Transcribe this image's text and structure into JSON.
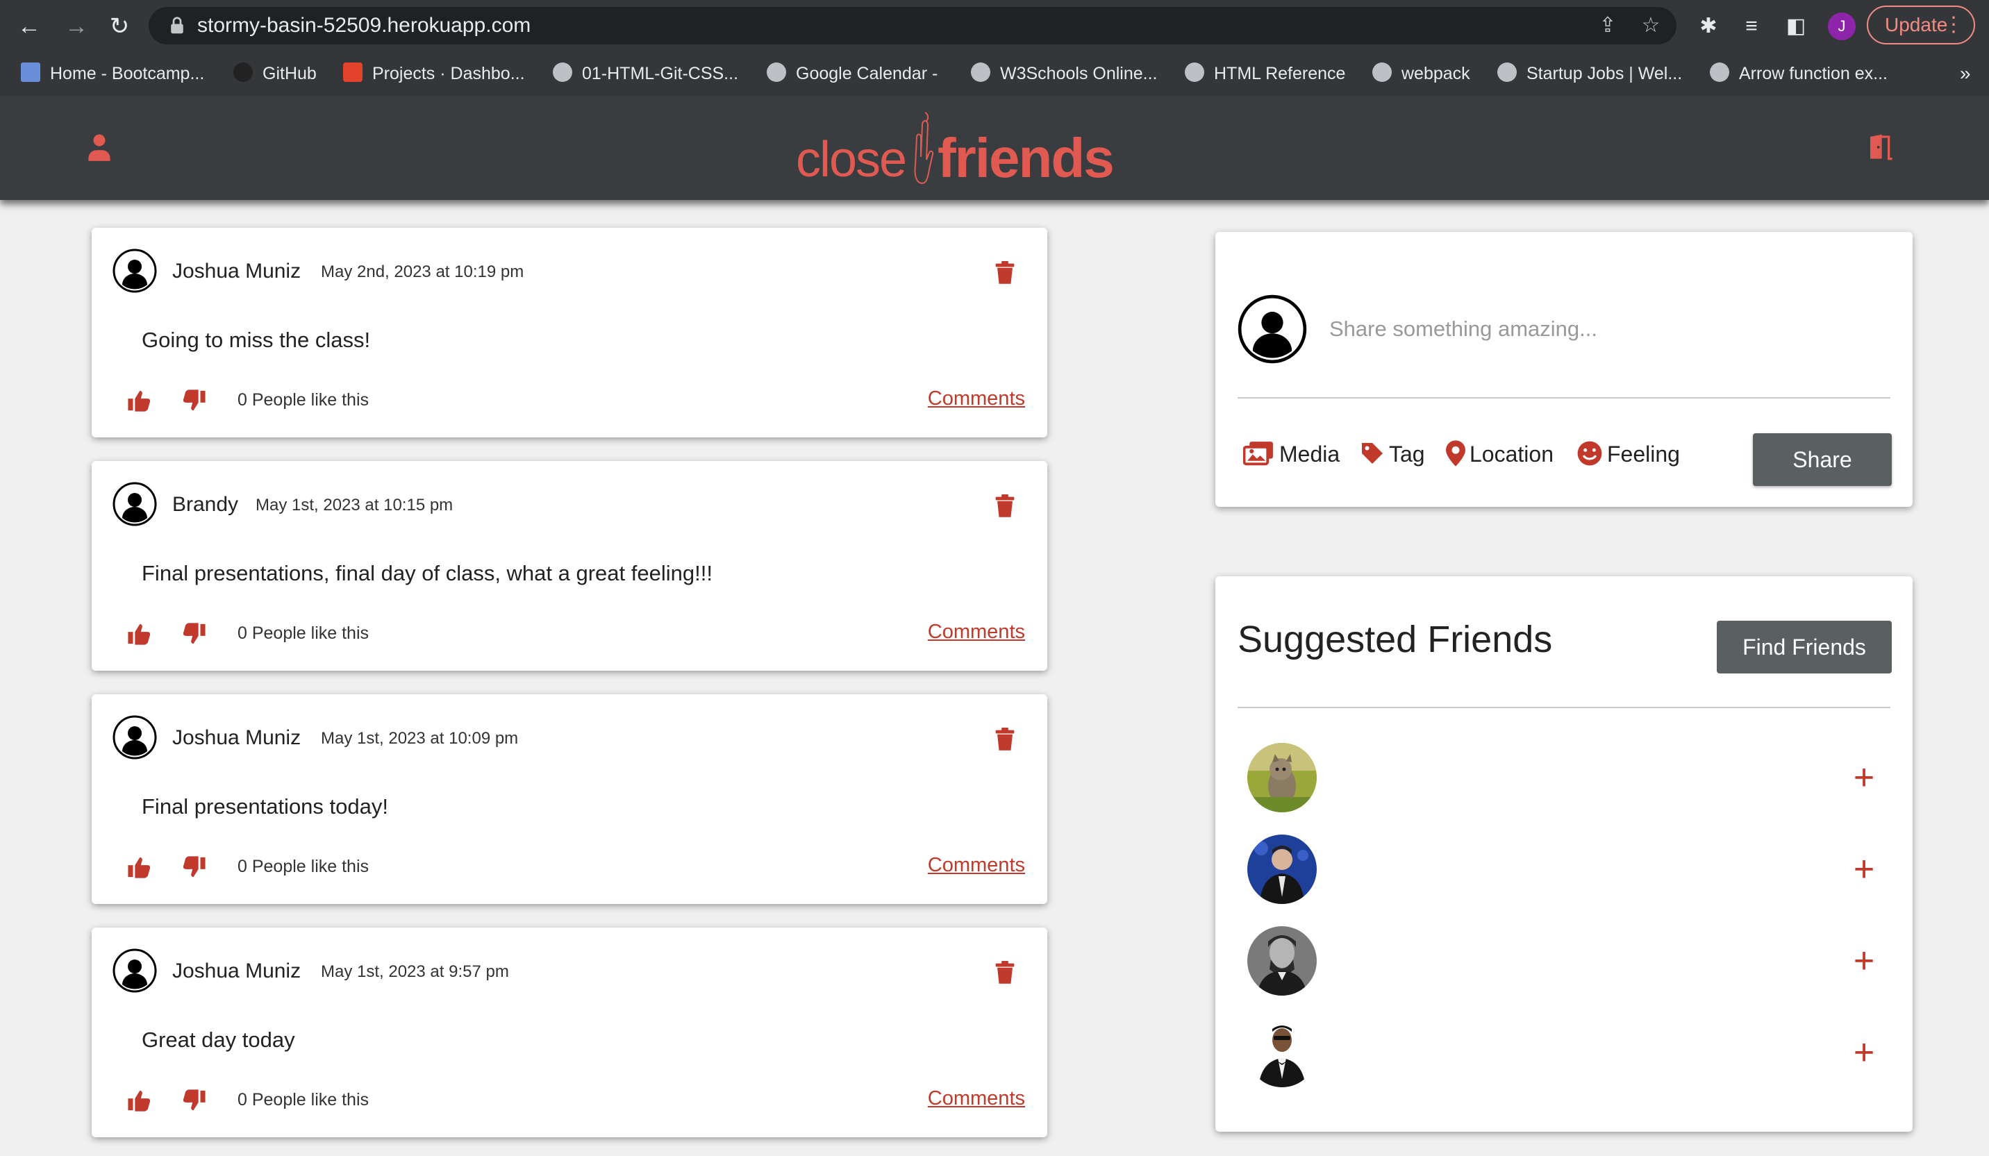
{
  "browser": {
    "url": "stormy-basin-52509.herokuapp.com",
    "profile_initial": "J",
    "update_label": "Update",
    "bookmarks": [
      {
        "label": "Home - Bootcamp..."
      },
      {
        "label": "GitHub"
      },
      {
        "label": "Projects · Dashbo..."
      },
      {
        "label": "01-HTML-Git-CSS..."
      },
      {
        "label": "Google Calendar -"
      },
      {
        "label": "W3Schools Online..."
      },
      {
        "label": "HTML Reference"
      },
      {
        "label": "webpack"
      },
      {
        "label": "Startup Jobs | Wel..."
      },
      {
        "label": "Arrow function ex..."
      }
    ],
    "bookmarks_overflow": "»"
  },
  "app": {
    "logo_part1": "close",
    "logo_part2": "friends",
    "accent_color": "#e05a52"
  },
  "posts": [
    {
      "author": "Joshua Muniz",
      "date": "May 2nd, 2023 at 10:19 pm",
      "content": "Going to miss the class!",
      "likes": "0 People like this",
      "comments_label": "Comments"
    },
    {
      "author": "Brandy",
      "date": "May 1st, 2023 at 10:15 pm",
      "content": "Final presentations, final day of class, what a great feeling!!!",
      "likes": "0 People like this",
      "comments_label": "Comments"
    },
    {
      "author": "Joshua Muniz",
      "date": "May 1st, 2023 at 10:09 pm",
      "content": "Final presentations today!",
      "likes": "0 People like this",
      "comments_label": "Comments"
    },
    {
      "author": "Joshua Muniz",
      "date": "May 1st, 2023 at 9:57 pm",
      "content": "Great day today",
      "likes": "0 People like this",
      "comments_label": "Comments"
    }
  ],
  "share": {
    "placeholder": "Share something amazing...",
    "options": {
      "media": "Media",
      "tag": "Tag",
      "location": "Location",
      "feeling": "Feeling"
    },
    "button": "Share"
  },
  "suggested": {
    "title": "Suggested Friends",
    "find_button": "Find Friends",
    "add_symbol": "+"
  }
}
